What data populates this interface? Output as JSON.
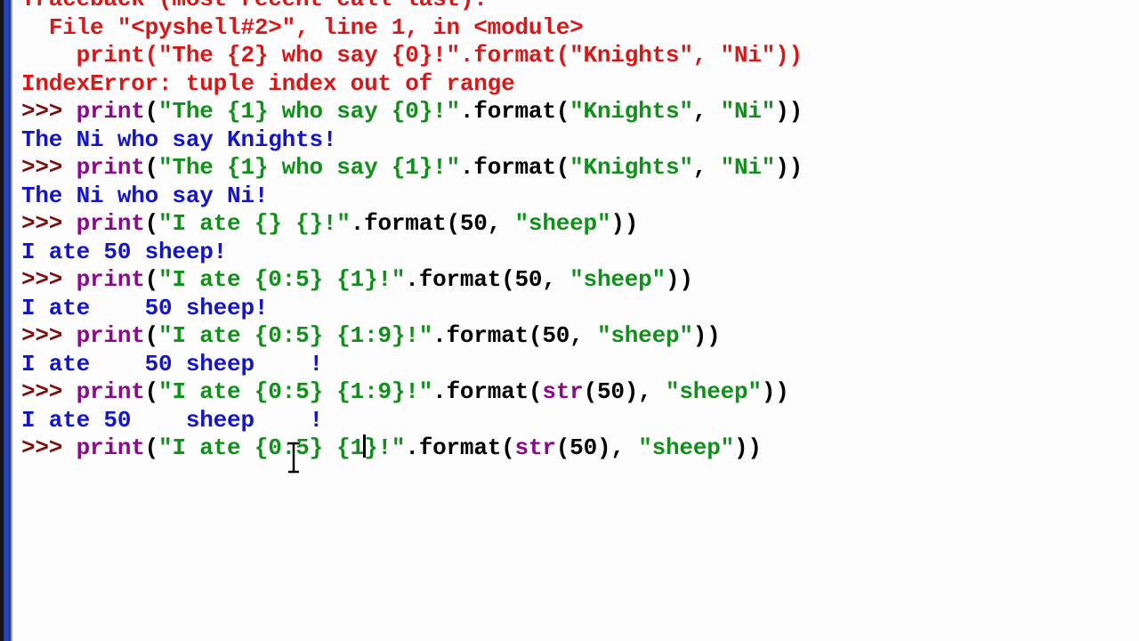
{
  "colors": {
    "prompt": "#7a1010",
    "builtin": "#8a0a8a",
    "string": "#10901a",
    "output": "#1414c8",
    "error": "#d81818"
  },
  "lines": [
    {
      "segments": [
        {
          "kind": "error",
          "text": "Traceback (most recent call last):"
        }
      ]
    },
    {
      "segments": [
        {
          "kind": "error",
          "text": "  File \"<pyshell#2>\", line 1, in <module>"
        }
      ]
    },
    {
      "segments": [
        {
          "kind": "error",
          "text": "    print(\"The {2} who say {0}!\".format(\"Knights\", \"Ni\"))"
        }
      ]
    },
    {
      "segments": [
        {
          "kind": "error",
          "text": "IndexError: tuple index out of range"
        }
      ]
    },
    {
      "segments": [
        {
          "kind": "prompt",
          "text": ">>> "
        },
        {
          "kind": "builtin",
          "text": "print"
        },
        {
          "kind": "plain",
          "text": "("
        },
        {
          "kind": "string",
          "text": "\"The {1} who say {0}!\""
        },
        {
          "kind": "plain",
          "text": ".format("
        },
        {
          "kind": "string",
          "text": "\"Knights\""
        },
        {
          "kind": "plain",
          "text": ", "
        },
        {
          "kind": "string",
          "text": "\"Ni\""
        },
        {
          "kind": "plain",
          "text": "))"
        }
      ]
    },
    {
      "segments": [
        {
          "kind": "output",
          "text": "The Ni who say Knights!"
        }
      ]
    },
    {
      "segments": [
        {
          "kind": "prompt",
          "text": ">>> "
        },
        {
          "kind": "builtin",
          "text": "print"
        },
        {
          "kind": "plain",
          "text": "("
        },
        {
          "kind": "string",
          "text": "\"The {1} who say {1}!\""
        },
        {
          "kind": "plain",
          "text": ".format("
        },
        {
          "kind": "string",
          "text": "\"Knights\""
        },
        {
          "kind": "plain",
          "text": ", "
        },
        {
          "kind": "string",
          "text": "\"Ni\""
        },
        {
          "kind": "plain",
          "text": "))"
        }
      ]
    },
    {
      "segments": [
        {
          "kind": "output",
          "text": "The Ni who say Ni!"
        }
      ]
    },
    {
      "segments": [
        {
          "kind": "prompt",
          "text": ">>> "
        },
        {
          "kind": "builtin",
          "text": "print"
        },
        {
          "kind": "plain",
          "text": "("
        },
        {
          "kind": "string",
          "text": "\"I ate {} {}!\""
        },
        {
          "kind": "plain",
          "text": ".format(50, "
        },
        {
          "kind": "string",
          "text": "\"sheep\""
        },
        {
          "kind": "plain",
          "text": "))"
        }
      ]
    },
    {
      "segments": [
        {
          "kind": "output",
          "text": "I ate 50 sheep!"
        }
      ]
    },
    {
      "segments": [
        {
          "kind": "prompt",
          "text": ">>> "
        },
        {
          "kind": "builtin",
          "text": "print"
        },
        {
          "kind": "plain",
          "text": "("
        },
        {
          "kind": "string",
          "text": "\"I ate {0:5} {1}!\""
        },
        {
          "kind": "plain",
          "text": ".format(50, "
        },
        {
          "kind": "string",
          "text": "\"sheep\""
        },
        {
          "kind": "plain",
          "text": "))"
        }
      ]
    },
    {
      "segments": [
        {
          "kind": "output",
          "text": "I ate    50 sheep!"
        }
      ]
    },
    {
      "segments": [
        {
          "kind": "prompt",
          "text": ">>> "
        },
        {
          "kind": "builtin",
          "text": "print"
        },
        {
          "kind": "plain",
          "text": "("
        },
        {
          "kind": "string",
          "text": "\"I ate {0:5} {1:9}!\""
        },
        {
          "kind": "plain",
          "text": ".format(50, "
        },
        {
          "kind": "string",
          "text": "\"sheep\""
        },
        {
          "kind": "plain",
          "text": "))"
        }
      ]
    },
    {
      "segments": [
        {
          "kind": "output",
          "text": "I ate    50 sheep    !"
        }
      ]
    },
    {
      "segments": [
        {
          "kind": "prompt",
          "text": ">>> "
        },
        {
          "kind": "builtin",
          "text": "print"
        },
        {
          "kind": "plain",
          "text": "("
        },
        {
          "kind": "string",
          "text": "\"I ate {0:5} {1:9}!\""
        },
        {
          "kind": "plain",
          "text": ".format("
        },
        {
          "kind": "builtin",
          "text": "str"
        },
        {
          "kind": "plain",
          "text": "(50), "
        },
        {
          "kind": "string",
          "text": "\"sheep\""
        },
        {
          "kind": "plain",
          "text": "))"
        }
      ]
    },
    {
      "segments": [
        {
          "kind": "output",
          "text": "I ate 50    sheep    !"
        }
      ]
    },
    {
      "segments": [
        {
          "kind": "prompt",
          "text": ">>> "
        },
        {
          "kind": "builtin",
          "text": "print"
        },
        {
          "kind": "plain",
          "text": "("
        },
        {
          "kind": "string",
          "text": "\"I ate {0:5} {1"
        },
        {
          "kind": "caret",
          "text": ""
        },
        {
          "kind": "string",
          "text": "}!\""
        },
        {
          "kind": "plain",
          "text": ".format("
        },
        {
          "kind": "builtin",
          "text": "str"
        },
        {
          "kind": "plain",
          "text": "(50), "
        },
        {
          "kind": "string",
          "text": "\"sheep\""
        },
        {
          "kind": "plain",
          "text": "))"
        }
      ]
    }
  ],
  "cursor": {
    "icon": "text-ibeam-cursor"
  }
}
